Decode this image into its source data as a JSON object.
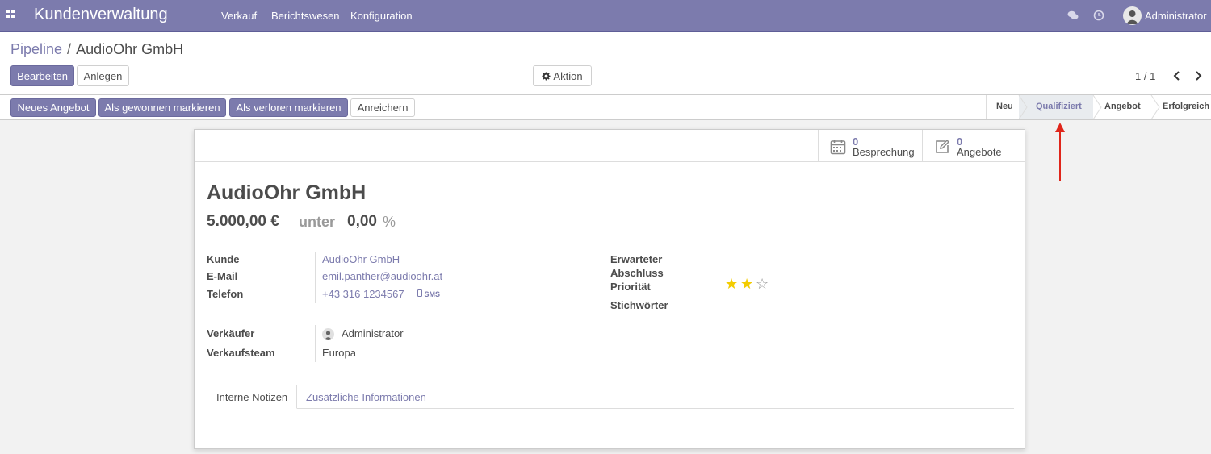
{
  "navbar": {
    "brand": "Kundenverwaltung",
    "menu": [
      "Verkauf",
      "Berichtswesen",
      "Konfiguration"
    ],
    "user": "Administrator"
  },
  "breadcrumb": {
    "parent": "Pipeline",
    "separator": "/",
    "current": "AudioOhr GmbH"
  },
  "toolbar": {
    "edit": "Bearbeiten",
    "create": "Anlegen",
    "action": "Aktion",
    "pager": "1 / 1"
  },
  "statusbar": {
    "buttons": [
      "Neues Angebot",
      "Als gewonnen markieren",
      "Als verloren markieren",
      "Anreichern"
    ],
    "stages": [
      "Neu",
      "Qualifiziert",
      "Angebot",
      "Erfolgreich"
    ],
    "active_stage": "Qualifiziert"
  },
  "smart_buttons": [
    {
      "count": "0",
      "label": "Besprechung",
      "icon": "calendar-icon"
    },
    {
      "count": "0",
      "label": "Angebote",
      "icon": "edit-icon"
    }
  ],
  "record": {
    "title": "AudioOhr GmbH",
    "revenue": "5.000,00 €",
    "unter": "unter",
    "probability": "0,00",
    "percent": "%"
  },
  "fields": {
    "customer_label": "Kunde",
    "customer_value": "AudioOhr GmbH",
    "email_label": "E-Mail",
    "email_value": "emil.panther@audioohr.at",
    "phone_label": "Telefon",
    "phone_value": "+43 316 1234567",
    "sms": "SMS",
    "expected_close_label_1": "Erwarteter",
    "expected_close_label_2": "Abschluss",
    "priority_label": "Priorität",
    "priority_value": 2,
    "priority_max": 3,
    "tags_label": "Stichwörter",
    "salesperson_label": "Verkäufer",
    "salesperson_value": "Administrator",
    "team_label": "Verkaufsteam",
    "team_value": "Europa"
  },
  "tabs": [
    "Interne Notizen",
    "Zusätzliche Informationen"
  ],
  "colors": {
    "brand": "#7c7bad",
    "star": "#f3cc00",
    "arrow": "#e0261b"
  }
}
